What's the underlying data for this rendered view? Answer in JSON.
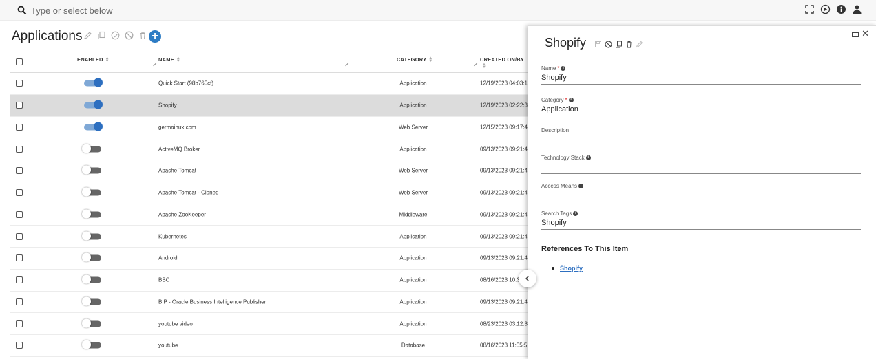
{
  "search": {
    "placeholder": "Type or select below"
  },
  "top_icons": [
    "fullscreen-icon",
    "play-icon",
    "info-icon",
    "user-icon"
  ],
  "page": {
    "title": "Applications"
  },
  "title_tools": [
    "edit-icon",
    "copy-icon",
    "check-icon",
    "block-icon",
    "trash-icon",
    "add-icon"
  ],
  "table": {
    "columns": {
      "enabled": "ENABLED",
      "name": "NAME",
      "category": "CATEGORY",
      "created": "CREATED ON/BY"
    },
    "rows": [
      {
        "enabled": true,
        "name": "Quick Start (98b765cf)",
        "category": "Application",
        "created": "12/19/2023 04:03:1",
        "selected": false
      },
      {
        "enabled": true,
        "name": "Shopify",
        "category": "Application",
        "created": "12/19/2023 02:22:3",
        "selected": true
      },
      {
        "enabled": true,
        "name": "germainux.com",
        "category": "Web Server",
        "created": "12/15/2023 09:17:4",
        "selected": false
      },
      {
        "enabled": false,
        "name": "ActiveMQ Broker",
        "category": "Application",
        "created": "09/13/2023 09:21:4",
        "selected": false
      },
      {
        "enabled": false,
        "name": "Apache Tomcat",
        "category": "Web Server",
        "created": "09/13/2023 09:21:4",
        "selected": false
      },
      {
        "enabled": false,
        "name": "Apache Tomcat - Cloned",
        "category": "Web Server",
        "created": "09/13/2023 09:21:4",
        "selected": false
      },
      {
        "enabled": false,
        "name": "Apache ZooKeeper",
        "category": "Middleware",
        "created": "09/13/2023 09:21:4",
        "selected": false
      },
      {
        "enabled": false,
        "name": "Kubernetes",
        "category": "Application",
        "created": "09/13/2023 09:21:4",
        "selected": false
      },
      {
        "enabled": false,
        "name": "Android",
        "category": "Application",
        "created": "09/13/2023 09:21:4",
        "selected": false
      },
      {
        "enabled": false,
        "name": "BBC",
        "category": "Application",
        "created": "08/16/2023 10:3",
        "selected": false
      },
      {
        "enabled": false,
        "name": "BIP - Oracle Business Intelligence Publisher",
        "category": "Application",
        "created": "09/13/2023 09:21:4",
        "selected": false
      },
      {
        "enabled": false,
        "name": "youtube video",
        "category": "Application",
        "created": "08/23/2023 03:12:3",
        "selected": false
      },
      {
        "enabled": false,
        "name": "youtube",
        "category": "Database",
        "created": "08/16/2023 11:55:5",
        "selected": false
      }
    ]
  },
  "panel": {
    "title": "Shopify",
    "tools": [
      "save-icon",
      "block-icon",
      "copy-icon",
      "trash-icon",
      "edit-icon"
    ],
    "fields": {
      "name": {
        "label": "Name",
        "required_mark": "*",
        "value": "Shopify"
      },
      "category": {
        "label": "Category",
        "required_mark": "*",
        "value": "Application"
      },
      "description": {
        "label": "Description",
        "value": ""
      },
      "tech_stack": {
        "label": "Technology Stack",
        "value": ""
      },
      "access_means": {
        "label": "Access Means",
        "value": ""
      },
      "search_tags": {
        "label": "Search Tags",
        "value": "Shopify"
      }
    },
    "references": {
      "heading": "References To This Item",
      "items": [
        "Shopify"
      ]
    }
  },
  "colors": {
    "accent": "#2d6fc0",
    "selected_row": "#dcdcdc",
    "toggle_on_track": "#7fa8d6"
  }
}
